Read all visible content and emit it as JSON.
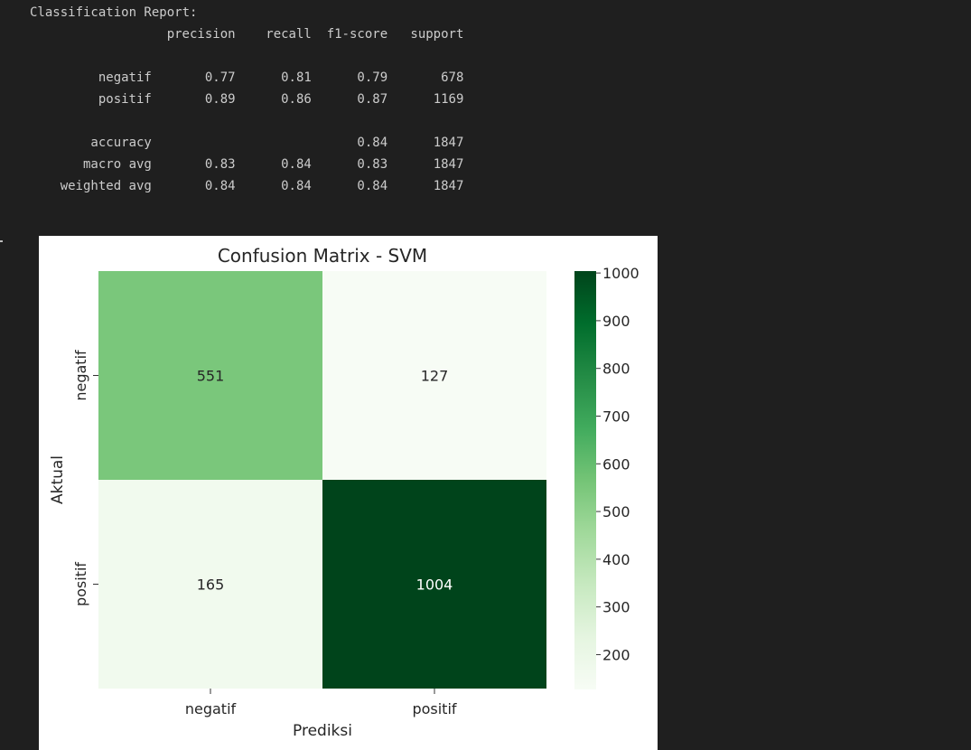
{
  "report": {
    "title": "Classification Report:",
    "headers": [
      "precision",
      "recall",
      "f1-score",
      "support"
    ],
    "rows": [
      {
        "label": "negatif",
        "values": [
          "0.77",
          "0.81",
          "0.79",
          "678"
        ]
      },
      {
        "label": "positif",
        "values": [
          "0.89",
          "0.86",
          "0.87",
          "1169"
        ]
      },
      {
        "label": "accuracy",
        "values": [
          "",
          "",
          "0.84",
          "1847"
        ]
      },
      {
        "label": "macro avg",
        "values": [
          "0.83",
          "0.84",
          "0.83",
          "1847"
        ]
      },
      {
        "label": "weighted avg",
        "values": [
          "0.84",
          "0.84",
          "0.84",
          "1847"
        ]
      }
    ]
  },
  "chart_data": {
    "type": "heatmap",
    "title": "Confusion Matrix - SVM",
    "xlabel": "Prediksi",
    "ylabel": "Aktual",
    "x_categories": [
      "negatif",
      "positif"
    ],
    "y_categories": [
      "negatif",
      "positif"
    ],
    "values": [
      [
        551,
        127
      ],
      [
        165,
        1004
      ]
    ],
    "colormap": "Greens",
    "colorbar": {
      "ticks": [
        200,
        300,
        400,
        500,
        600,
        700,
        800,
        900,
        1000
      ],
      "range": [
        127,
        1004
      ]
    },
    "grid": false,
    "legend": "colorbar-right"
  }
}
